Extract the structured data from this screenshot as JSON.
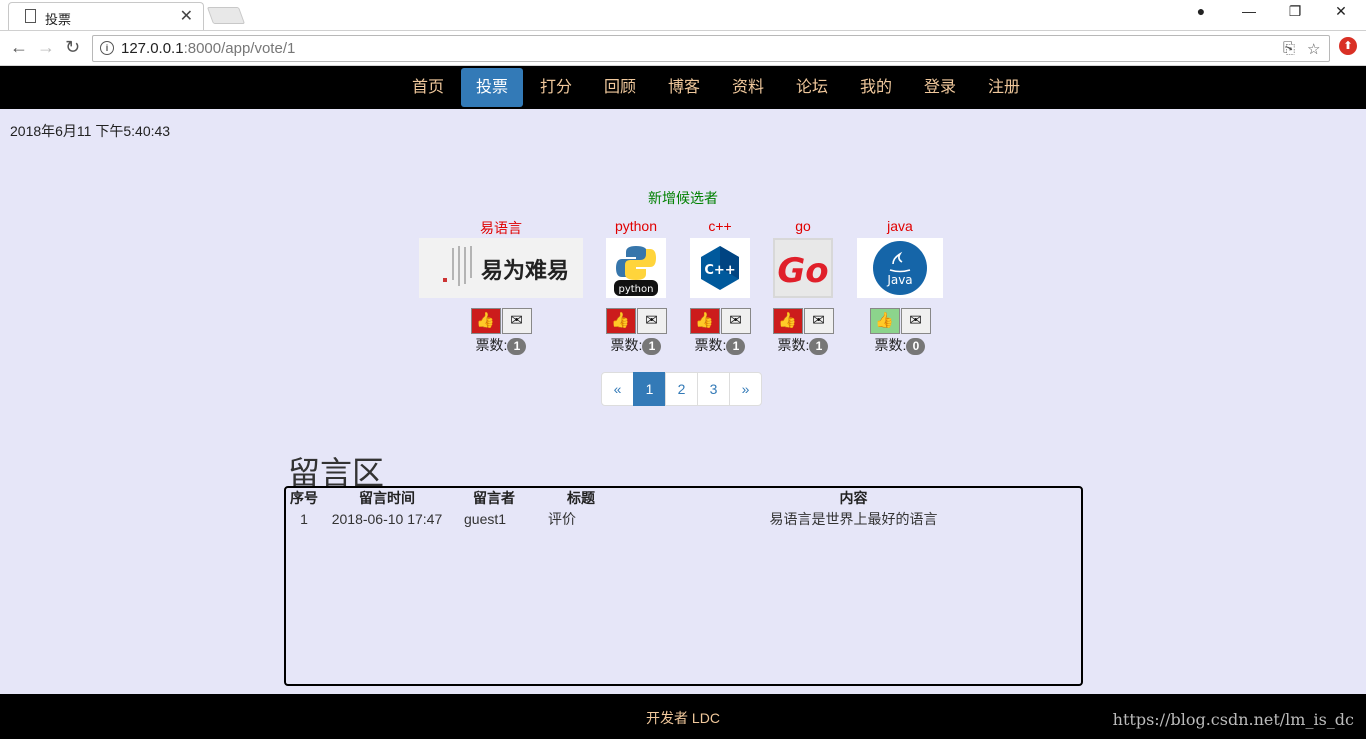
{
  "browser": {
    "tab_title": "投票",
    "url_host": "127.0.0.1",
    "url_rest": ":8000/app/vote/1"
  },
  "nav": {
    "items": [
      {
        "label": "首页",
        "active": false
      },
      {
        "label": "投票",
        "active": true
      },
      {
        "label": "打分",
        "active": false
      },
      {
        "label": "回顾",
        "active": false
      },
      {
        "label": "博客",
        "active": false
      },
      {
        "label": "资料",
        "active": false
      },
      {
        "label": "论坛",
        "active": false
      },
      {
        "label": "我的",
        "active": false
      },
      {
        "label": "登录",
        "active": false
      },
      {
        "label": "注册",
        "active": false
      }
    ]
  },
  "clock": "2018年6月11 下午5:40:43",
  "add_candidate": "新增候选者",
  "candidates": [
    {
      "name": "易语言",
      "votes_label": "票数:",
      "votes": "1",
      "logo": "calligraphy-logo",
      "logo_text": "易为难易"
    },
    {
      "name": "python",
      "votes_label": "票数:",
      "votes": "1",
      "logo": "python-logo",
      "logo_text": "python"
    },
    {
      "name": "c++",
      "votes_label": "票数:",
      "votes": "1",
      "logo": "cpp-logo",
      "logo_text": "C++"
    },
    {
      "name": "go",
      "votes_label": "票数:",
      "votes": "1",
      "logo": "go-logo",
      "logo_text": "Go"
    },
    {
      "name": "java",
      "votes_label": "票数:",
      "votes": "0",
      "logo": "java-logo",
      "logo_text": "Java"
    }
  ],
  "pagination": {
    "prev": "«",
    "pages": [
      "1",
      "2",
      "3"
    ],
    "current": "1",
    "next": "»"
  },
  "messages": {
    "title": "留言区",
    "headers": [
      "序号",
      "留言时间",
      "留言者",
      "标题",
      "内容"
    ],
    "rows": [
      {
        "no": "1",
        "time": "2018-06-10 17:47",
        "author": "guest1",
        "title": "评价",
        "content": "易语言是世界上最好的语言"
      }
    ]
  },
  "footer": {
    "text": "开发者 LDC",
    "watermark": "https://blog.csdn.net/lm_is_dc"
  },
  "colors": {
    "nav_active": "#337ab7",
    "like_button": "#cc1c1c",
    "like_button_zero": "#8cd48c",
    "candidate_name": "#e00000",
    "add_link": "#008000"
  }
}
